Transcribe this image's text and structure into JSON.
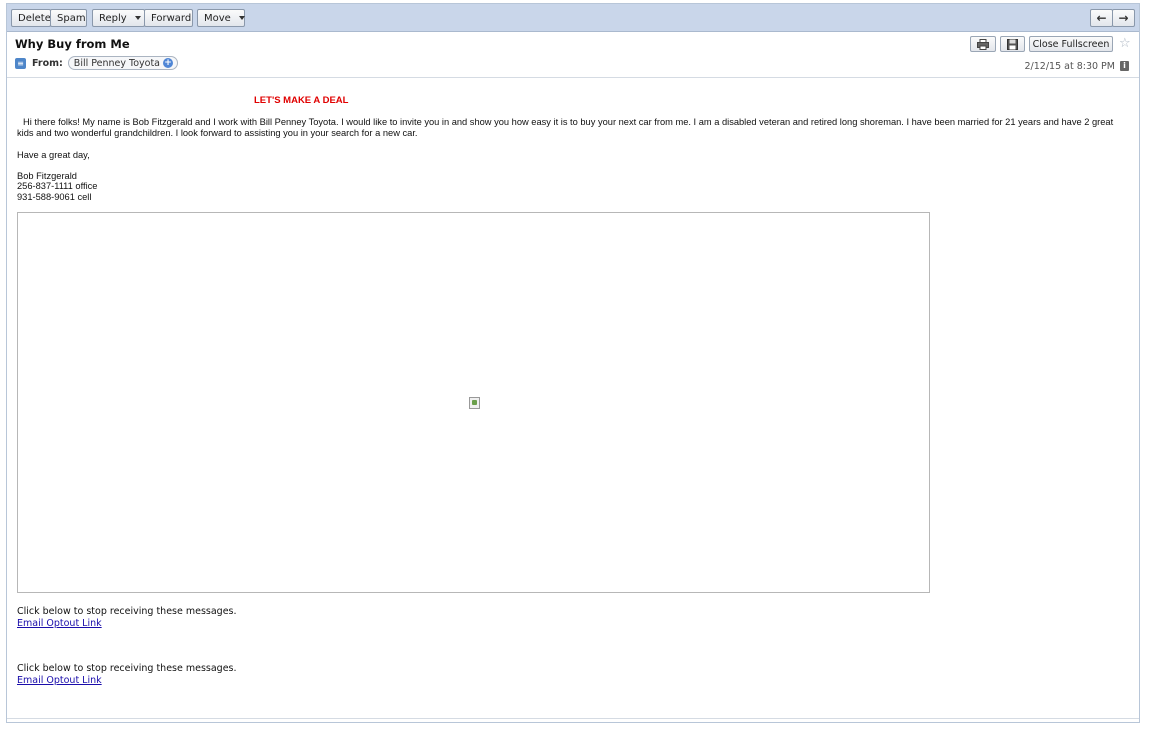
{
  "toolbar": {
    "delete": "Delete",
    "spam": "Spam",
    "reply": "Reply",
    "forward": "Forward",
    "move": "Move",
    "prev_icon": "arrow-left-icon",
    "next_icon": "arrow-right-icon"
  },
  "header": {
    "subject": "Why Buy from Me",
    "from_label": "From:",
    "sender": "Bill Penney Toyota",
    "date": "2/12/15 at 8:30 PM",
    "close_fullscreen": "Close Fullscreen"
  },
  "body": {
    "headline": "LET'S MAKE A DEAL",
    "paragraph": "Hi there folks! My name is Bob Fitzgerald and I work with Bill Penney Toyota. I would like to invite you in and show you how easy it is to buy your next car from me. I am a disabled veteran and retired long shoreman. I have been married for 21 years and have 2 great kids and two wonderful grandchildren. I look forward to assisting you in your search for a new car.",
    "closing": "Have a great day,",
    "signature": {
      "name": "Bob Fitzgerald",
      "office": "256-837-1111 office",
      "cell": "931-588-9061 cell"
    },
    "optout": [
      {
        "text": "Click below to stop receiving these messages.",
        "link": "Email Optout Link "
      },
      {
        "text": "Click below to stop receiving these messages.",
        "link": "Email Optout Link"
      }
    ]
  },
  "colors": {
    "toolbar_bg": "#c9d6ea",
    "headline": "#e00000",
    "link": "#1a0dab"
  }
}
